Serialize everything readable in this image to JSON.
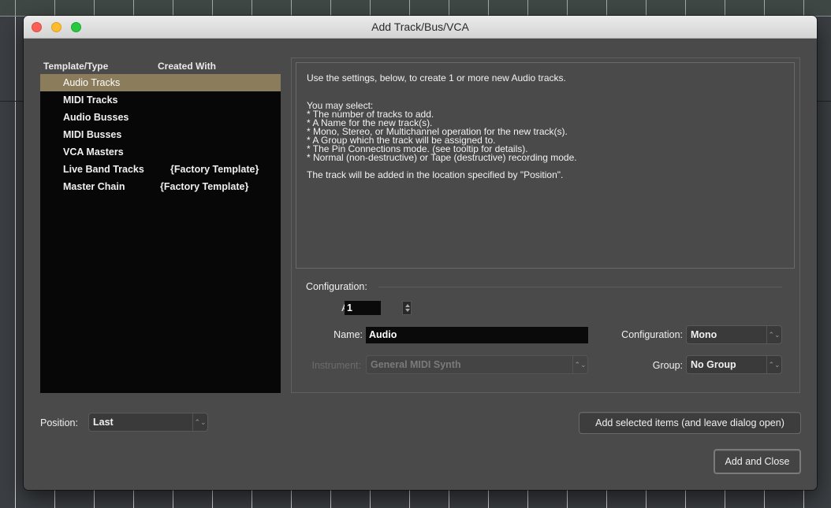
{
  "window": {
    "title": "Add Track/Bus/VCA"
  },
  "template_list": {
    "headers": {
      "type": "Template/Type",
      "created_with": "Created With"
    },
    "items": [
      {
        "name": "Audio Tracks",
        "created_with": "",
        "selected": true
      },
      {
        "name": "MIDI Tracks",
        "created_with": ""
      },
      {
        "name": "Audio Busses",
        "created_with": ""
      },
      {
        "name": "MIDI Busses",
        "created_with": ""
      },
      {
        "name": "VCA Masters",
        "created_with": ""
      },
      {
        "name": "Live Band Tracks",
        "created_with": "{Factory Template}"
      },
      {
        "name": "Master Chain",
        "created_with": "{Factory Template}"
      }
    ]
  },
  "description": {
    "lines": [
      "Use the settings, below, to create 1 or more new Audio tracks.",
      "",
      "",
      "You may select:",
      "* The number of tracks to add.",
      "* A Name for the new track(s).",
      "* Mono, Stereo, or Multichannel operation for the new track(s).",
      "* A Group which the track will be assigned to.",
      "* The Pin Connections mode. (see tooltip for details).",
      "* Normal (non-destructive) or Tape (destructive) recording mode.",
      "",
      "The track will be added in the location specified by \"Position\"."
    ]
  },
  "configuration": {
    "heading": "Configuration:",
    "add_label": "Add:",
    "add_value": "1",
    "name_label": "Name:",
    "name_value": "Audio",
    "instrument_label": "Instrument:",
    "instrument_value": "General MIDI Synth",
    "configuration_label": "Configuration:",
    "configuration_value": "Mono",
    "group_label": "Group:",
    "group_value": "No Group"
  },
  "position": {
    "label": "Position:",
    "value": "Last"
  },
  "buttons": {
    "add_selected": "Add selected items (and leave dialog open)",
    "add_and_close": "Add and Close"
  },
  "colors": {
    "selection": "#8b7d5b",
    "dialog_bg": "#4a4a4a",
    "list_bg": "#070707"
  }
}
